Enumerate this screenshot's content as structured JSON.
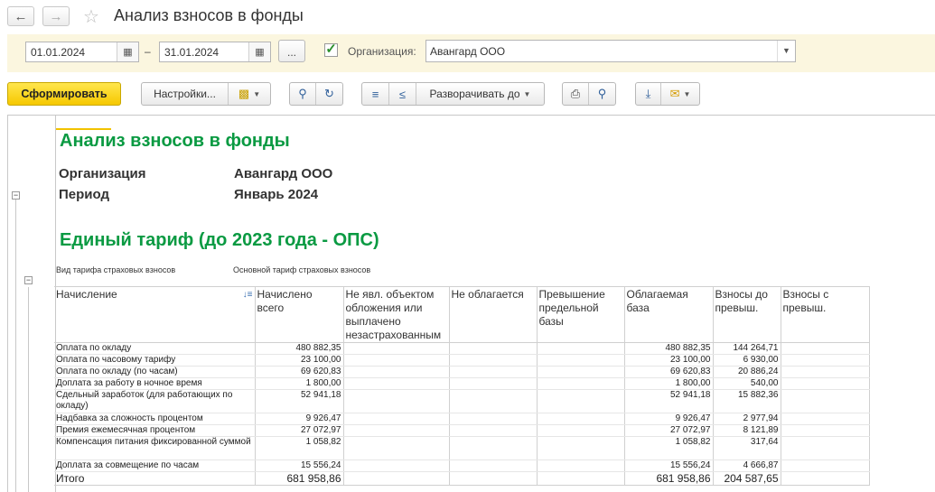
{
  "window": {
    "title": "Анализ взносов в фонды",
    "back_icon": "arrow-left",
    "forward_icon": "arrow-right",
    "favorite_icon": "star"
  },
  "filters": {
    "date_from": "01.01.2024",
    "date_to": "31.01.2024",
    "dash": "–",
    "dots": "...",
    "org_checked": true,
    "org_label": "Организация:",
    "org_value": "Авангард ООО"
  },
  "toolbar": {
    "generate": "Сформировать",
    "settings": "Настройки...",
    "expand": "Разворачивать до"
  },
  "report": {
    "title": "Анализ взносов в фонды",
    "org_label": "Организация",
    "org_value": "Авангард ООО",
    "period_label": "Период",
    "period_value": "Январь 2024",
    "section_title": "Единый тариф (до 2023 года - ОПС)",
    "tariff_label": "Вид тарифа страховых взносов",
    "tariff_value": "Основной тариф страховых взносов",
    "columns": [
      "Начисление",
      "Начислено всего",
      "Не явл. объектом обложения или выплачено незастрахованным",
      "Не облагается",
      "Превышение предельной базы",
      "Облагаемая база",
      "Взносы до превыш.",
      "Взносы с превыш."
    ],
    "rows": [
      {
        "name": "Оплата по окладу",
        "total": "480 882,35",
        "base": "480 882,35",
        "contrib": "144 264,71"
      },
      {
        "name": "Оплата по часовому тарифу",
        "total": "23 100,00",
        "base": "23 100,00",
        "contrib": "6 930,00"
      },
      {
        "name": "Оплата по окладу (по часам)",
        "total": "69 620,83",
        "base": "69 620,83",
        "contrib": "20 886,24"
      },
      {
        "name": "Доплата за работу в ночное время",
        "total": "1 800,00",
        "base": "1 800,00",
        "contrib": "540,00"
      },
      {
        "name": "Сдельный заработок (для работающих по окладу)",
        "total": "52 941,18",
        "base": "52 941,18",
        "contrib": "15 882,36"
      },
      {
        "name": "Надбавка за сложность процентом",
        "total": "9 926,47",
        "base": "9 926,47",
        "contrib": "2 977,94"
      },
      {
        "name": "Премия ежемесячная процентом",
        "total": "27 072,97",
        "base": "27 072,97",
        "contrib": "8 121,89"
      },
      {
        "name": "Компенсация питания фиксированной суммой",
        "total": "1 058,82",
        "base": "1 058,82",
        "contrib": "317,64"
      },
      {
        "name": "Доплата за совмещение по часам",
        "total": "15 556,24",
        "base": "15 556,24",
        "contrib": "4 666,87"
      }
    ],
    "total": {
      "name": "Итого",
      "total": "681 958,86",
      "base": "681 958,86",
      "contrib": "204 587,65"
    }
  }
}
